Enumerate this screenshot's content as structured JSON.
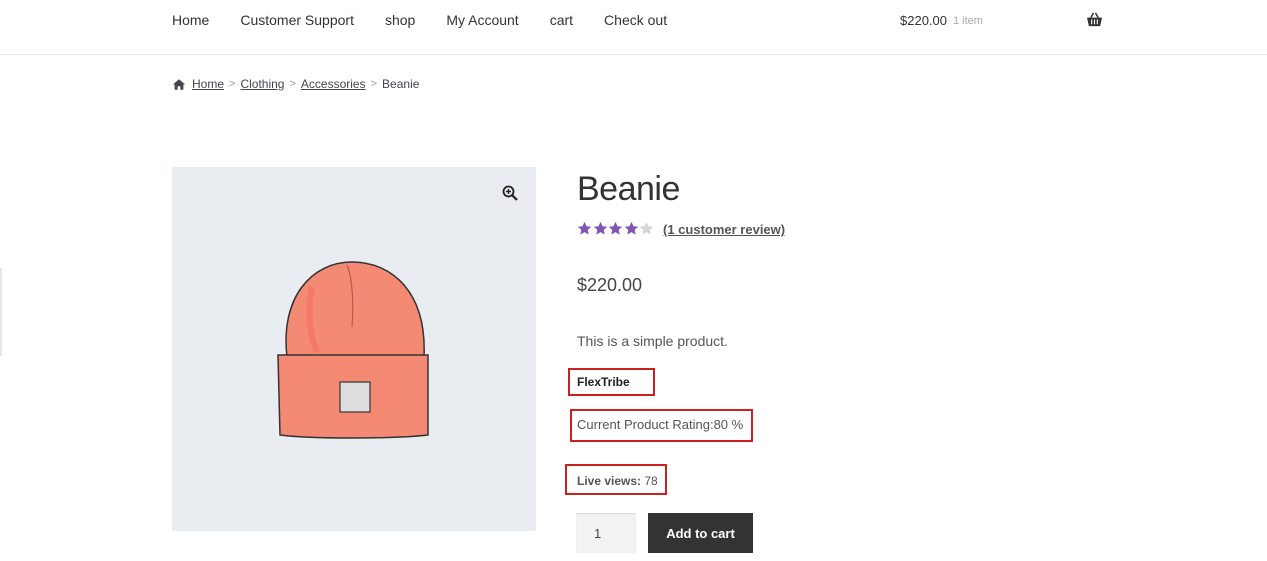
{
  "nav": {
    "items": [
      {
        "label": "Home"
      },
      {
        "label": "Customer Support"
      },
      {
        "label": "shop"
      },
      {
        "label": "My Account"
      },
      {
        "label": "cart"
      },
      {
        "label": "Check out"
      }
    ]
  },
  "cart": {
    "total": "$220.00",
    "count": "1 item",
    "icon": "basket-icon"
  },
  "breadcrumb": {
    "home_icon": "home-icon",
    "items": [
      "Home",
      "Clothing",
      "Accessories"
    ],
    "current": "Beanie",
    "separator": ">"
  },
  "product": {
    "title": "Beanie",
    "rating": 4,
    "rating_max": 5,
    "review_link": "(1 customer review)",
    "price": "$220.00",
    "description": "This is a simple product.",
    "brand": "FlexTribe",
    "current_rating": "Current Product Rating:80 %",
    "live_views_label": "Live views:",
    "live_views_value": "78",
    "quantity": "1",
    "add_to_cart_label": "Add to cart"
  },
  "colors": {
    "star_filled": "#7f54b3",
    "star_empty": "#d6d6d6",
    "highlight_box": "#cc1f1f",
    "button_bg": "#333333",
    "gallery_bg": "#e9edf2"
  }
}
